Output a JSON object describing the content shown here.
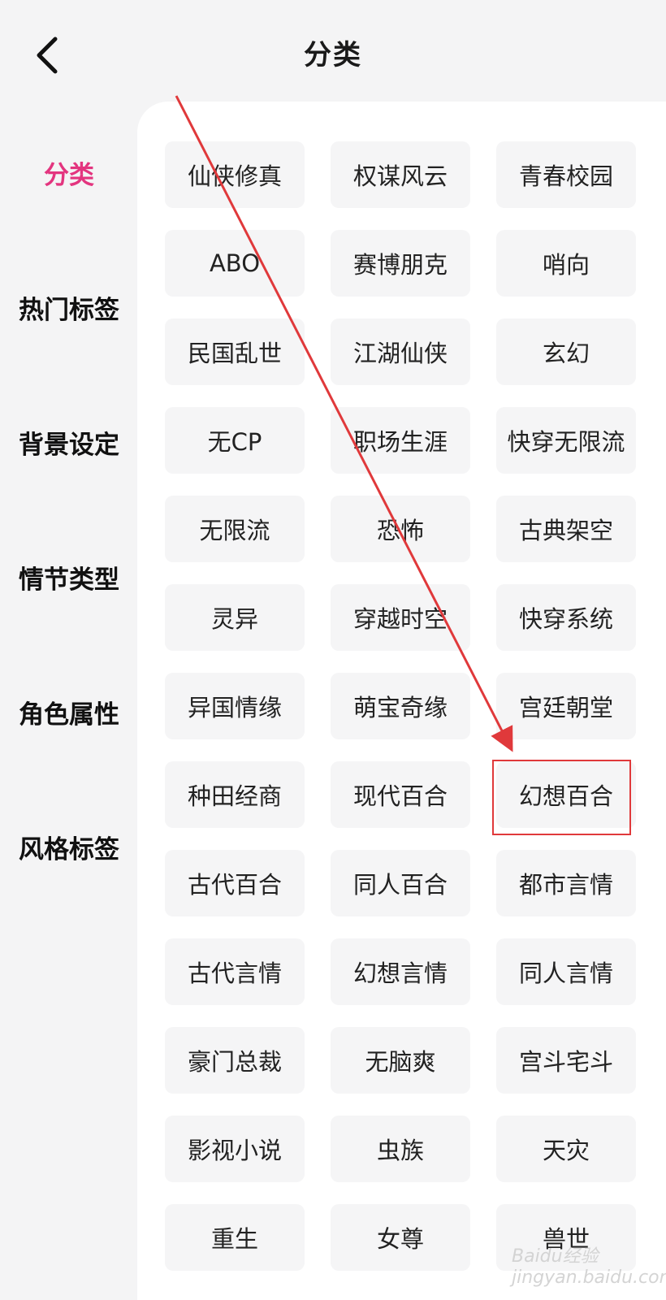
{
  "header": {
    "title": "分类"
  },
  "sidebar": {
    "items": [
      {
        "label": "分类",
        "active": true
      },
      {
        "label": "热门标签",
        "active": false
      },
      {
        "label": "背景设定",
        "active": false
      },
      {
        "label": "情节类型",
        "active": false
      },
      {
        "label": "角色属性",
        "active": false
      },
      {
        "label": "风格标签",
        "active": false
      }
    ]
  },
  "tags": [
    "仙侠修真",
    "权谋风云",
    "青春校园",
    "ABO",
    "赛博朋克",
    "哨向",
    "民国乱世",
    "江湖仙侠",
    "玄幻",
    "无CP",
    "职场生涯",
    "快穿无限流",
    "无限流",
    "恐怖",
    "古典架空",
    "灵异",
    "穿越时空",
    "快穿系统",
    "异国情缘",
    "萌宝奇缘",
    "宫廷朝堂",
    "种田经商",
    "现代百合",
    "幻想百合",
    "古代百合",
    "同人百合",
    "都市言情",
    "古代言情",
    "幻想言情",
    "同人言情",
    "豪门总裁",
    "无脑爽",
    "宫斗宅斗",
    "影视小说",
    "虫族",
    "天灾",
    "重生",
    "女尊",
    "兽世"
  ],
  "annotation": {
    "highlighted_tag": "幻想百合",
    "color": "#e0393b"
  },
  "colors": {
    "accent": "#e3357f",
    "tag_bg": "#f5f5f6",
    "panel_bg": "#ffffff",
    "page_bg": "#f4f4f5"
  },
  "watermark": "Baidu经验 jingyan.baidu.com"
}
